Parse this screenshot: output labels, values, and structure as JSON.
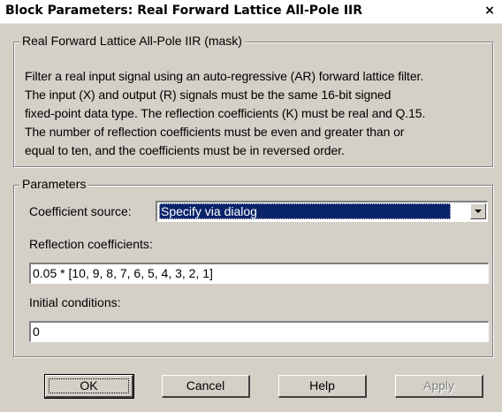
{
  "window": {
    "title": "Block Parameters: Real Forward Lattice All-Pole IIR",
    "close_glyph": "×"
  },
  "mask_group": {
    "label": "Real Forward Lattice All-Pole IIR (mask)",
    "description_lines": [
      "Filter a real input signal using an auto-regressive (AR) forward lattice filter.",
      "The input (X) and output (R) signals must be the same 16-bit signed",
      "fixed-point data type. The reflection coefficients (K) must be real and Q.15.",
      "The number of reflection coefficients must be even and greater than or",
      "equal to ten, and the coefficients must be in reversed order."
    ]
  },
  "params_group": {
    "label": "Parameters",
    "coef_source": {
      "label": "Coefficient source:",
      "value": "Specify via dialog"
    },
    "reflection": {
      "label": "Reflection coefficients:",
      "value": "0.05 * [10, 9, 8, 7, 6, 5, 4, 3, 2, 1]"
    },
    "initial": {
      "label": "Initial conditions:",
      "value": "0"
    }
  },
  "buttons": {
    "ok": "OK",
    "cancel": "Cancel",
    "help": "Help",
    "apply": "Apply"
  }
}
